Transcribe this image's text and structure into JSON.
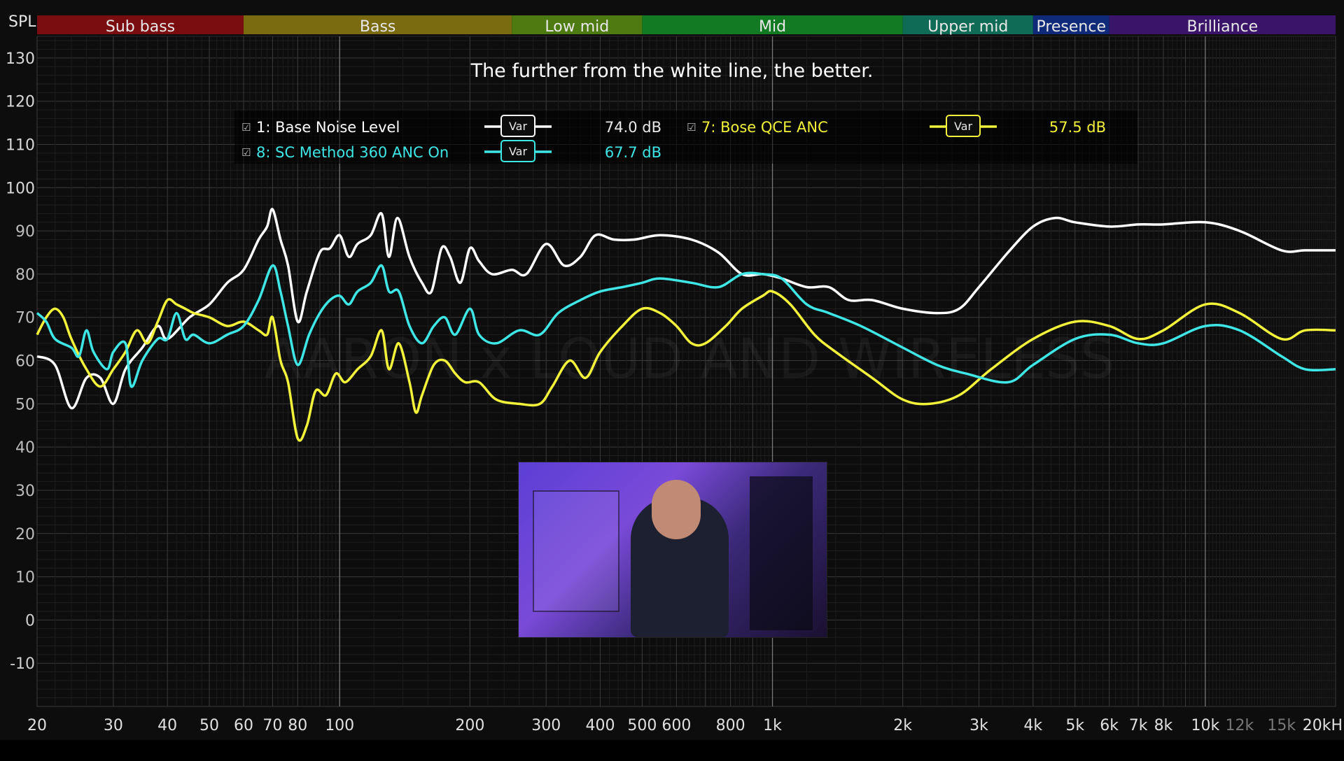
{
  "chart_data": {
    "type": "line",
    "title": "The further from the white line, the better.",
    "ylabel": "SPL",
    "xlabel": "",
    "x_scale": "log",
    "xlim": [
      20,
      20000
    ],
    "ylim": [
      -20,
      135
    ],
    "grid": true,
    "legend_placement": "top-center",
    "watermark": "AARON x LOUD AND WIRELESS",
    "y_ticks": [
      "130",
      "120",
      "110",
      "100",
      "90",
      "80",
      "70",
      "60",
      "50",
      "40",
      "30",
      "20",
      "10",
      "0",
      "-10"
    ],
    "y_tick_values": [
      130,
      120,
      110,
      100,
      90,
      80,
      70,
      60,
      50,
      40,
      30,
      20,
      10,
      0,
      -10
    ],
    "x_ticks": [
      {
        "v": 20,
        "label": "20"
      },
      {
        "v": 30,
        "label": "30"
      },
      {
        "v": 40,
        "label": "40"
      },
      {
        "v": 50,
        "label": "50"
      },
      {
        "v": 60,
        "label": "60"
      },
      {
        "v": 70,
        "label": "70"
      },
      {
        "v": 80,
        "label": "80"
      },
      {
        "v": 100,
        "label": "100"
      },
      {
        "v": 200,
        "label": "200"
      },
      {
        "v": 300,
        "label": "300"
      },
      {
        "v": 400,
        "label": "400"
      },
      {
        "v": 500,
        "label": "500"
      },
      {
        "v": 600,
        "label": "600"
      },
      {
        "v": 800,
        "label": "800"
      },
      {
        "v": 1000,
        "label": "1k"
      },
      {
        "v": 2000,
        "label": "2k"
      },
      {
        "v": 3000,
        "label": "3k"
      },
      {
        "v": 4000,
        "label": "4k"
      },
      {
        "v": 5000,
        "label": "5k"
      },
      {
        "v": 6000,
        "label": "6k"
      },
      {
        "v": 7000,
        "label": "7k"
      },
      {
        "v": 8000,
        "label": "8k"
      },
      {
        "v": 10000,
        "label": "10k"
      },
      {
        "v": 12000,
        "label": "12k",
        "dim": true
      },
      {
        "v": 15000,
        "label": "15k",
        "dim": true
      },
      {
        "v": 20000,
        "label": "20kH"
      }
    ],
    "bands": [
      {
        "name": "Sub bass",
        "from": 20,
        "to": 60,
        "color": "#7a0d10"
      },
      {
        "name": "Bass",
        "from": 60,
        "to": 250,
        "color": "#7a6a10"
      },
      {
        "name": "Low mid",
        "from": 250,
        "to": 500,
        "color": "#4e7a12"
      },
      {
        "name": "Mid",
        "from": 500,
        "to": 2000,
        "color": "#127a22"
      },
      {
        "name": "Upper mid",
        "from": 2000,
        "to": 4000,
        "color": "#0f6b55"
      },
      {
        "name": "Presence",
        "from": 4000,
        "to": 6000,
        "color": "#102a7a"
      },
      {
        "name": "Brilliance",
        "from": 6000,
        "to": 20000,
        "color": "#3a1468"
      }
    ],
    "legend": [
      {
        "check": "☑",
        "name": "1: Base Noise Level",
        "var": "Var",
        "value": "74.0 dB",
        "color": "#ffffff"
      },
      {
        "check": "☑",
        "name": "7: Bose QCE ANC",
        "var": "Var",
        "value": "57.5 dB",
        "color": "#f2f23a"
      },
      {
        "check": "☑",
        "name": "8: SC Method 360 ANC On",
        "var": "Var",
        "value": "67.7 dB",
        "color": "#3ee6e6"
      }
    ],
    "series": [
      {
        "name": "1: Base Noise Level",
        "color": "#ffffff",
        "points": [
          [
            20,
            61
          ],
          [
            22,
            59
          ],
          [
            24,
            49
          ],
          [
            26,
            56
          ],
          [
            28,
            56
          ],
          [
            30,
            50
          ],
          [
            32,
            58
          ],
          [
            35,
            63
          ],
          [
            38,
            68
          ],
          [
            40,
            65
          ],
          [
            45,
            70
          ],
          [
            50,
            73
          ],
          [
            55,
            78
          ],
          [
            60,
            81
          ],
          [
            65,
            88
          ],
          [
            68,
            91
          ],
          [
            70,
            95
          ],
          [
            73,
            88
          ],
          [
            76,
            82
          ],
          [
            80,
            69
          ],
          [
            84,
            76
          ],
          [
            90,
            85
          ],
          [
            95,
            86
          ],
          [
            100,
            89
          ],
          [
            105,
            84
          ],
          [
            110,
            87
          ],
          [
            118,
            89
          ],
          [
            125,
            94
          ],
          [
            130,
            84
          ],
          [
            136,
            93
          ],
          [
            145,
            84
          ],
          [
            155,
            78
          ],
          [
            163,
            76
          ],
          [
            172,
            86
          ],
          [
            180,
            84
          ],
          [
            190,
            78
          ],
          [
            200,
            86
          ],
          [
            210,
            83
          ],
          [
            225,
            80
          ],
          [
            250,
            81
          ],
          [
            270,
            80
          ],
          [
            300,
            87
          ],
          [
            330,
            82
          ],
          [
            360,
            84
          ],
          [
            390,
            89
          ],
          [
            430,
            88
          ],
          [
            480,
            88
          ],
          [
            550,
            89
          ],
          [
            650,
            88
          ],
          [
            750,
            85
          ],
          [
            850,
            80
          ],
          [
            950,
            80
          ],
          [
            1050,
            79
          ],
          [
            1200,
            77
          ],
          [
            1350,
            77
          ],
          [
            1500,
            74
          ],
          [
            1700,
            74
          ],
          [
            2000,
            72
          ],
          [
            2400,
            71
          ],
          [
            2700,
            72
          ],
          [
            3000,
            77
          ],
          [
            3500,
            85
          ],
          [
            4000,
            91
          ],
          [
            4500,
            93
          ],
          [
            5000,
            92
          ],
          [
            6000,
            91
          ],
          [
            7000,
            91.5
          ],
          [
            8000,
            91.5
          ],
          [
            10000,
            92
          ],
          [
            12000,
            90
          ],
          [
            15000,
            85.5
          ],
          [
            17000,
            85.5
          ],
          [
            20000,
            85.5
          ]
        ]
      },
      {
        "name": "7: Bose QCE ANC",
        "color": "#f2f23a",
        "points": [
          [
            20,
            66
          ],
          [
            21,
            70
          ],
          [
            22,
            72
          ],
          [
            23,
            70
          ],
          [
            24,
            65
          ],
          [
            26,
            58
          ],
          [
            28,
            54
          ],
          [
            30,
            58
          ],
          [
            32,
            62
          ],
          [
            34,
            67
          ],
          [
            36,
            64
          ],
          [
            38,
            69
          ],
          [
            40,
            74
          ],
          [
            42,
            73
          ],
          [
            44,
            72
          ],
          [
            46,
            71
          ],
          [
            50,
            70
          ],
          [
            55,
            68
          ],
          [
            60,
            69
          ],
          [
            65,
            67
          ],
          [
            68,
            66
          ],
          [
            70,
            70
          ],
          [
            73,
            60
          ],
          [
            76,
            55
          ],
          [
            80,
            42
          ],
          [
            84,
            45
          ],
          [
            88,
            53
          ],
          [
            93,
            52
          ],
          [
            98,
            57
          ],
          [
            103,
            55
          ],
          [
            110,
            58
          ],
          [
            118,
            61
          ],
          [
            125,
            67
          ],
          [
            130,
            58
          ],
          [
            137,
            64
          ],
          [
            145,
            55
          ],
          [
            150,
            48
          ],
          [
            155,
            52
          ],
          [
            165,
            59
          ],
          [
            175,
            60
          ],
          [
            185,
            57
          ],
          [
            195,
            55
          ],
          [
            210,
            55
          ],
          [
            230,
            51
          ],
          [
            260,
            50
          ],
          [
            290,
            50
          ],
          [
            310,
            54
          ],
          [
            340,
            60
          ],
          [
            370,
            56
          ],
          [
            400,
            62
          ],
          [
            450,
            68
          ],
          [
            500,
            72
          ],
          [
            550,
            71
          ],
          [
            600,
            68
          ],
          [
            650,
            64
          ],
          [
            700,
            64
          ],
          [
            780,
            68
          ],
          [
            850,
            72
          ],
          [
            950,
            75
          ],
          [
            1000,
            76
          ],
          [
            1100,
            73
          ],
          [
            1250,
            66
          ],
          [
            1400,
            62
          ],
          [
            1700,
            56
          ],
          [
            2000,
            51
          ],
          [
            2300,
            50
          ],
          [
            2700,
            52
          ],
          [
            3200,
            58
          ],
          [
            4000,
            65
          ],
          [
            5000,
            69
          ],
          [
            6000,
            68
          ],
          [
            7000,
            65
          ],
          [
            8000,
            67
          ],
          [
            10000,
            73
          ],
          [
            12000,
            71
          ],
          [
            15000,
            65
          ],
          [
            17000,
            67
          ],
          [
            20000,
            67
          ]
        ]
      },
      {
        "name": "8: SC Method 360 ANC On",
        "color": "#3ee6e6",
        "points": [
          [
            20,
            71
          ],
          [
            21,
            69
          ],
          [
            22,
            65
          ],
          [
            24,
            63
          ],
          [
            25,
            61
          ],
          [
            26,
            67
          ],
          [
            27,
            62
          ],
          [
            29,
            58
          ],
          [
            30,
            62
          ],
          [
            32,
            64
          ],
          [
            33,
            54
          ],
          [
            35,
            60
          ],
          [
            38,
            65
          ],
          [
            40,
            65
          ],
          [
            42,
            71
          ],
          [
            44,
            65
          ],
          [
            46,
            66
          ],
          [
            50,
            64
          ],
          [
            55,
            66
          ],
          [
            60,
            68
          ],
          [
            65,
            74
          ],
          [
            70,
            82
          ],
          [
            73,
            76
          ],
          [
            76,
            68
          ],
          [
            80,
            59
          ],
          [
            85,
            66
          ],
          [
            90,
            71
          ],
          [
            95,
            74
          ],
          [
            100,
            75
          ],
          [
            105,
            73
          ],
          [
            110,
            76
          ],
          [
            118,
            78
          ],
          [
            125,
            82
          ],
          [
            130,
            76
          ],
          [
            137,
            76
          ],
          [
            145,
            68
          ],
          [
            155,
            64
          ],
          [
            165,
            68
          ],
          [
            175,
            70
          ],
          [
            185,
            66
          ],
          [
            200,
            72
          ],
          [
            210,
            66
          ],
          [
            230,
            64
          ],
          [
            260,
            67
          ],
          [
            290,
            66
          ],
          [
            320,
            71
          ],
          [
            360,
            74
          ],
          [
            400,
            76
          ],
          [
            450,
            77
          ],
          [
            500,
            78
          ],
          [
            550,
            79
          ],
          [
            650,
            78
          ],
          [
            750,
            77
          ],
          [
            850,
            80
          ],
          [
            950,
            80
          ],
          [
            1050,
            79
          ],
          [
            1200,
            73
          ],
          [
            1350,
            71
          ],
          [
            1600,
            68
          ],
          [
            2000,
            63
          ],
          [
            2400,
            59
          ],
          [
            2800,
            57
          ],
          [
            3500,
            55
          ],
          [
            4000,
            59
          ],
          [
            5000,
            65
          ],
          [
            6000,
            66
          ],
          [
            7000,
            64
          ],
          [
            8000,
            64
          ],
          [
            10000,
            68
          ],
          [
            12000,
            67
          ],
          [
            15000,
            61
          ],
          [
            17000,
            58
          ],
          [
            20000,
            58
          ]
        ]
      }
    ]
  }
}
